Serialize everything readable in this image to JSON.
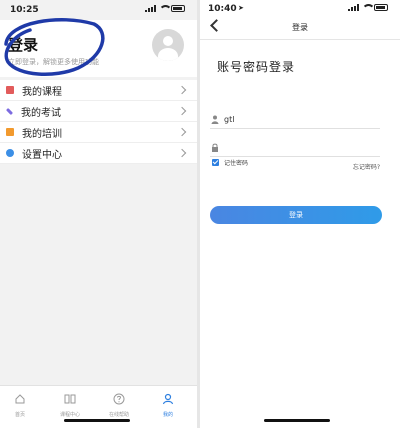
{
  "left": {
    "status_time": "10:25",
    "login_title": "登录",
    "login_subtitle": "立即登录，解锁更多使用功能",
    "menu": [
      {
        "label": "我的课程",
        "icon": "course-icon",
        "color": "#e25b5b"
      },
      {
        "label": "我的考试",
        "icon": "exam-icon",
        "color": "#7c6be0"
      },
      {
        "label": "我的培训",
        "icon": "training-icon",
        "color": "#f29a2e"
      },
      {
        "label": "设置中心",
        "icon": "settings-icon",
        "color": "#3c8fe6"
      }
    ],
    "tabs": [
      {
        "label": "首页",
        "icon": "home-icon",
        "active": false
      },
      {
        "label": "课程中心",
        "icon": "book-icon",
        "active": false
      },
      {
        "label": "在线帮助",
        "icon": "help-icon",
        "active": false
      },
      {
        "label": "我的",
        "icon": "person-icon",
        "active": true
      }
    ]
  },
  "right": {
    "status_time": "10:40",
    "nav_title": "登录",
    "form_title": "账号密码登录",
    "username_value": "gtl",
    "password_value": "",
    "remember_label": "记住密码",
    "remember_checked": true,
    "forgot_label": "忘记密码?",
    "login_button": "登录"
  },
  "colors": {
    "accent": "#2d7fe0",
    "scribble": "#1f3aa8"
  }
}
